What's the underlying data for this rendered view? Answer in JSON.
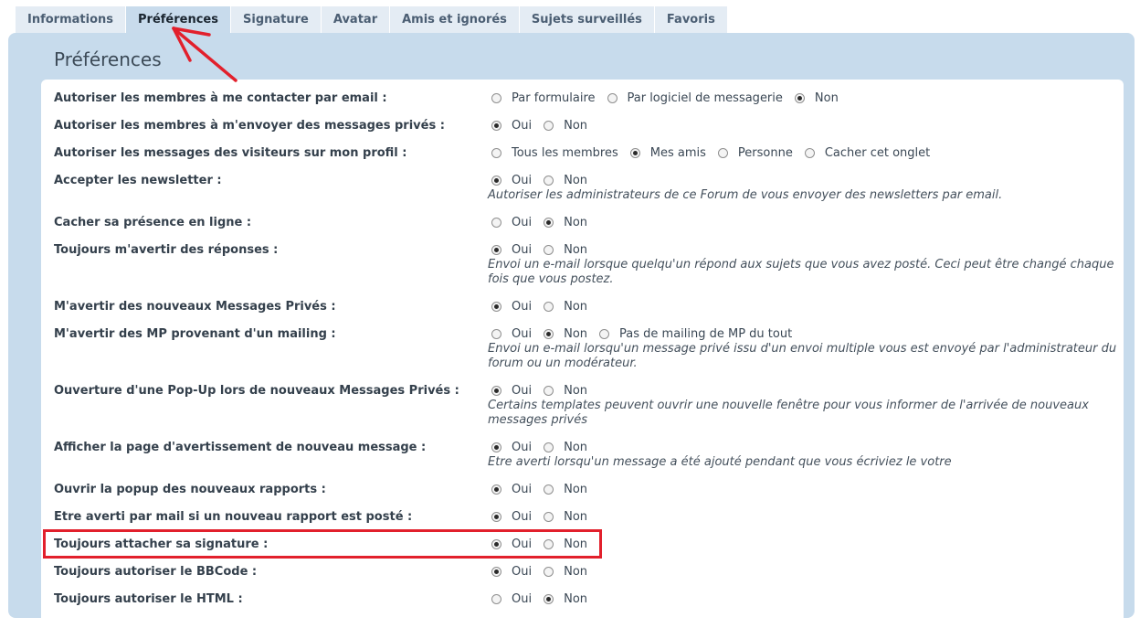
{
  "tabs": [
    {
      "label": "Informations",
      "active": false
    },
    {
      "label": "Préférences",
      "active": true
    },
    {
      "label": "Signature",
      "active": false
    },
    {
      "label": "Avatar",
      "active": false
    },
    {
      "label": "Amis et ignorés",
      "active": false
    },
    {
      "label": "Sujets surveillés",
      "active": false
    },
    {
      "label": "Favoris",
      "active": false
    }
  ],
  "panel": {
    "title": "Préférences"
  },
  "rows": [
    {
      "label": "Autoriser les membres à me contacter par email :",
      "options": [
        {
          "label": "Par formulaire",
          "checked": false
        },
        {
          "label": "Par logiciel de messagerie",
          "checked": false
        },
        {
          "label": "Non",
          "checked": true
        }
      ],
      "help": ""
    },
    {
      "label": "Autoriser les membres à m'envoyer des messages privés :",
      "options": [
        {
          "label": "Oui",
          "checked": true
        },
        {
          "label": "Non",
          "checked": false
        }
      ],
      "help": ""
    },
    {
      "label": "Autoriser les messages des visiteurs sur mon profil :",
      "options": [
        {
          "label": "Tous les membres",
          "checked": false
        },
        {
          "label": "Mes amis",
          "checked": true
        },
        {
          "label": "Personne",
          "checked": false
        },
        {
          "label": "Cacher cet onglet",
          "checked": false
        }
      ],
      "help": ""
    },
    {
      "label": "Accepter les newsletter :",
      "options": [
        {
          "label": "Oui",
          "checked": true
        },
        {
          "label": "Non",
          "checked": false
        }
      ],
      "help": "Autoriser les administrateurs de ce Forum de vous envoyer des newsletters par email."
    },
    {
      "label": "Cacher sa présence en ligne :",
      "options": [
        {
          "label": "Oui",
          "checked": false
        },
        {
          "label": "Non",
          "checked": true
        }
      ],
      "help": ""
    },
    {
      "label": "Toujours m'avertir des réponses :",
      "options": [
        {
          "label": "Oui",
          "checked": true
        },
        {
          "label": "Non",
          "checked": false
        }
      ],
      "help": "Envoi un e-mail lorsque quelqu'un répond aux sujets que vous avez posté. Ceci peut être changé chaque fois que vous postez."
    },
    {
      "label": "M'avertir des nouveaux Messages Privés :",
      "options": [
        {
          "label": "Oui",
          "checked": true
        },
        {
          "label": "Non",
          "checked": false
        }
      ],
      "help": ""
    },
    {
      "label": "M'avertir des MP provenant d'un mailing :",
      "options": [
        {
          "label": "Oui",
          "checked": false
        },
        {
          "label": "Non",
          "checked": true
        },
        {
          "label": "Pas de mailing de MP du tout",
          "checked": false
        }
      ],
      "help": "Envoi un e-mail lorsqu'un message privé issu d'un envoi multiple vous est envoyé par l'administrateur du forum ou un modérateur."
    },
    {
      "label": "Ouverture d'une Pop-Up lors de nouveaux Messages Privés :",
      "options": [
        {
          "label": "Oui",
          "checked": true
        },
        {
          "label": "Non",
          "checked": false
        }
      ],
      "help": "Certains templates peuvent ouvrir une nouvelle fenêtre pour vous informer de l'arrivée de nouveaux messages privés"
    },
    {
      "label": "Afficher la page d'avertissement de nouveau message :",
      "options": [
        {
          "label": "Oui",
          "checked": true
        },
        {
          "label": "Non",
          "checked": false
        }
      ],
      "help": "Etre averti lorsqu'un message a été ajouté pendant que vous écriviez le votre"
    },
    {
      "label": "Ouvrir la popup des nouveaux rapports :",
      "options": [
        {
          "label": "Oui",
          "checked": true
        },
        {
          "label": "Non",
          "checked": false
        }
      ],
      "help": ""
    },
    {
      "label": "Etre averti par mail si un nouveau rapport est posté :",
      "options": [
        {
          "label": "Oui",
          "checked": true
        },
        {
          "label": "Non",
          "checked": false
        }
      ],
      "help": ""
    },
    {
      "label": "Toujours attacher sa signature :",
      "options": [
        {
          "label": "Oui",
          "checked": true
        },
        {
          "label": "Non",
          "checked": false
        }
      ],
      "help": ""
    },
    {
      "label": "Toujours autoriser le BBCode :",
      "options": [
        {
          "label": "Oui",
          "checked": true
        },
        {
          "label": "Non",
          "checked": false
        }
      ],
      "help": ""
    },
    {
      "label": "Toujours autoriser le HTML :",
      "options": [
        {
          "label": "Oui",
          "checked": false
        },
        {
          "label": "Non",
          "checked": true
        }
      ],
      "help": ""
    }
  ]
}
